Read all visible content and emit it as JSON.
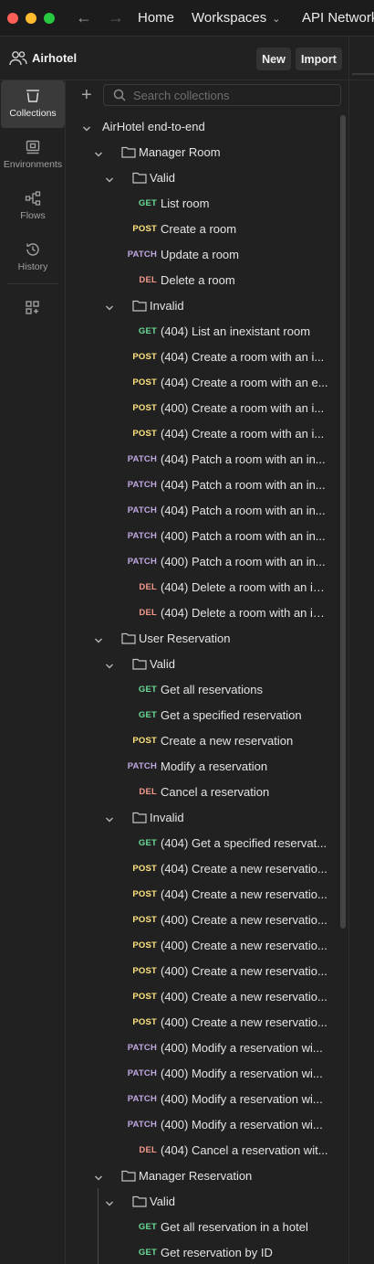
{
  "topbar": {
    "back_icon": "arrow-left-icon",
    "forward_icon": "arrow-right-icon",
    "home": "Home",
    "workspaces": "Workspaces",
    "api_network": "API Network"
  },
  "workspace": {
    "name": "Airhotel",
    "new_label": "New",
    "import_label": "Import"
  },
  "rail": {
    "collections": "Collections",
    "environments": "Environments",
    "flows": "Flows",
    "history": "History"
  },
  "search": {
    "placeholder": "Search collections"
  },
  "colors": {
    "GET": "#6bdd9a",
    "POST": "#ffe47e",
    "PATCH": "#c0a8e1",
    "DEL": "#f79a8e"
  },
  "tree": [
    {
      "type": "collection",
      "depth": 0,
      "label": "AirHotel end-to-end"
    },
    {
      "type": "folder",
      "depth": 1,
      "label": "Manager Room"
    },
    {
      "type": "folder",
      "depth": 2,
      "label": "Valid"
    },
    {
      "type": "request",
      "depth": 3,
      "method": "GET",
      "label": "List room"
    },
    {
      "type": "request",
      "depth": 3,
      "method": "POST",
      "label": "Create a room"
    },
    {
      "type": "request",
      "depth": 3,
      "method": "PATCH",
      "label": "Update a room"
    },
    {
      "type": "request",
      "depth": 3,
      "method": "DEL",
      "label": "Delete a room"
    },
    {
      "type": "folder",
      "depth": 2,
      "label": "Invalid"
    },
    {
      "type": "request",
      "depth": 3,
      "method": "GET",
      "label": "(404) List an inexistant room"
    },
    {
      "type": "request",
      "depth": 3,
      "method": "POST",
      "label": "(404) Create a room with an i..."
    },
    {
      "type": "request",
      "depth": 3,
      "method": "POST",
      "label": "(404) Create a room with an e..."
    },
    {
      "type": "request",
      "depth": 3,
      "method": "POST",
      "label": "(400) Create a room with an i..."
    },
    {
      "type": "request",
      "depth": 3,
      "method": "POST",
      "label": "(404) Create a room with an i..."
    },
    {
      "type": "request",
      "depth": 3,
      "method": "PATCH",
      "label": "(404) Patch a room with an in..."
    },
    {
      "type": "request",
      "depth": 3,
      "method": "PATCH",
      "label": "(404) Patch a room with an in..."
    },
    {
      "type": "request",
      "depth": 3,
      "method": "PATCH",
      "label": "(404) Patch a room with an in..."
    },
    {
      "type": "request",
      "depth": 3,
      "method": "PATCH",
      "label": "(400) Patch a room with an in..."
    },
    {
      "type": "request",
      "depth": 3,
      "method": "PATCH",
      "label": "(400) Patch a room with an in..."
    },
    {
      "type": "request",
      "depth": 3,
      "method": "DEL",
      "label": "(404) Delete a room with an in..."
    },
    {
      "type": "request",
      "depth": 3,
      "method": "DEL",
      "label": "(404) Delete a room with an in..."
    },
    {
      "type": "folder",
      "depth": 1,
      "label": "User Reservation"
    },
    {
      "type": "folder",
      "depth": 2,
      "label": "Valid"
    },
    {
      "type": "request",
      "depth": 3,
      "method": "GET",
      "label": "Get all reservations"
    },
    {
      "type": "request",
      "depth": 3,
      "method": "GET",
      "label": "Get a specified reservation"
    },
    {
      "type": "request",
      "depth": 3,
      "method": "POST",
      "label": "Create a new reservation"
    },
    {
      "type": "request",
      "depth": 3,
      "method": "PATCH",
      "label": "Modify a reservation"
    },
    {
      "type": "request",
      "depth": 3,
      "method": "DEL",
      "label": "Cancel a reservation"
    },
    {
      "type": "folder",
      "depth": 2,
      "label": "Invalid"
    },
    {
      "type": "request",
      "depth": 3,
      "method": "GET",
      "label": "(404) Get a specified reservat..."
    },
    {
      "type": "request",
      "depth": 3,
      "method": "POST",
      "label": "(404) Create a new reservatio..."
    },
    {
      "type": "request",
      "depth": 3,
      "method": "POST",
      "label": "(404) Create a new reservatio..."
    },
    {
      "type": "request",
      "depth": 3,
      "method": "POST",
      "label": "(400) Create a new reservatio..."
    },
    {
      "type": "request",
      "depth": 3,
      "method": "POST",
      "label": "(400) Create a new reservatio..."
    },
    {
      "type": "request",
      "depth": 3,
      "method": "POST",
      "label": "(400) Create a new reservatio..."
    },
    {
      "type": "request",
      "depth": 3,
      "method": "POST",
      "label": "(400) Create a new reservatio..."
    },
    {
      "type": "request",
      "depth": 3,
      "method": "POST",
      "label": "(400) Create a new reservatio..."
    },
    {
      "type": "request",
      "depth": 3,
      "method": "PATCH",
      "label": "(400) Modify a reservation wi..."
    },
    {
      "type": "request",
      "depth": 3,
      "method": "PATCH",
      "label": "(400) Modify a reservation wi..."
    },
    {
      "type": "request",
      "depth": 3,
      "method": "PATCH",
      "label": "(400) Modify a reservation wi..."
    },
    {
      "type": "request",
      "depth": 3,
      "method": "PATCH",
      "label": "(400) Modify a reservation wi..."
    },
    {
      "type": "request",
      "depth": 3,
      "method": "DEL",
      "label": "(404) Cancel a reservation wit..."
    },
    {
      "type": "folder",
      "depth": 1,
      "label": "Manager Reservation"
    },
    {
      "type": "folder",
      "depth": 2,
      "label": "Valid"
    },
    {
      "type": "request",
      "depth": 3,
      "method": "GET",
      "label": "Get all reservation in a hotel"
    },
    {
      "type": "request",
      "depth": 3,
      "method": "GET",
      "label": "Get reservation by ID"
    }
  ]
}
